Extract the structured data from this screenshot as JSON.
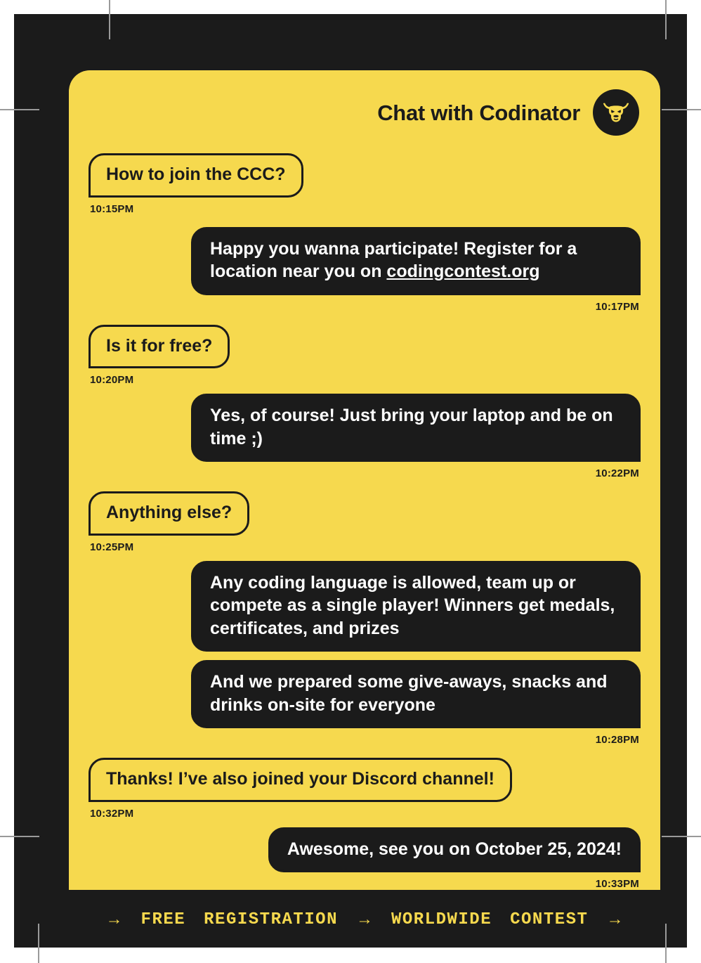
{
  "header": {
    "title": "Chat with Codinator",
    "avatar_icon": "bull-head-icon"
  },
  "colors": {
    "card_yellow": "#F6D94E",
    "ink_black": "#1B1B1B",
    "bubble_text_light": "#FFFFFF",
    "crop_mark_gray": "#9A9A9A",
    "sheet_white": "#FFFFFF"
  },
  "messages": [
    {
      "direction": "out",
      "text": "How to join the CCC?",
      "time": "10:15PM",
      "time_align": "left"
    },
    {
      "direction": "in",
      "text_before_link": "Happy you wanna participate! Register for a location near you on ",
      "link_text": "codingcontest.org",
      "text_after_link": "",
      "time": "10:17PM",
      "time_align": "right"
    },
    {
      "direction": "out",
      "text": "Is it for free?",
      "time": "10:20PM",
      "time_align": "left"
    },
    {
      "direction": "in",
      "text": "Yes, of course! Just bring your laptop and be on time ;)",
      "time": "10:22PM",
      "time_align": "right"
    },
    {
      "direction": "out",
      "text": "Anything else?",
      "time": "10:25PM",
      "time_align": "left"
    },
    {
      "direction": "in",
      "text": "Any coding language is allowed, team up or compete as a single player! Winners get medals, certificates, and prizes",
      "time": "",
      "time_align": "right"
    },
    {
      "direction": "in",
      "text": "And we prepared some give-aways, snacks and drinks on-site for everyone",
      "time": "10:28PM",
      "time_align": "right"
    },
    {
      "direction": "out",
      "text": "Thanks! I’ve also joined your Discord channel!",
      "time": "10:32PM",
      "time_align": "left"
    },
    {
      "direction": "in",
      "text": "Awesome, see you on October 25, 2024!",
      "time": "10:33PM",
      "time_align": "right"
    }
  ],
  "ticker": {
    "arrow_glyph": "→",
    "items": [
      {
        "type": "arrow",
        "label": "→"
      },
      {
        "type": "word",
        "label": "FREE"
      },
      {
        "type": "word",
        "label": "REGISTRATION"
      },
      {
        "type": "arrow",
        "label": "→"
      },
      {
        "type": "word",
        "label": "WORLDWIDE"
      },
      {
        "type": "word",
        "label": "CONTEST"
      },
      {
        "type": "arrow",
        "label": "→"
      }
    ]
  }
}
